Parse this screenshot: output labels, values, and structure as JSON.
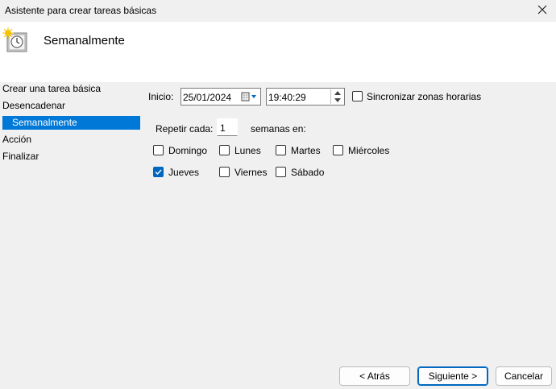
{
  "window": {
    "title": "Asistente para crear tareas básicas"
  },
  "header": {
    "title": "Semanalmente",
    "icon": "task-scheduler-icon"
  },
  "sidebar": {
    "items": [
      {
        "label": "Crear una tarea básica"
      },
      {
        "label": "Desencadenar"
      },
      {
        "label": "Semanalmente",
        "selected": true
      },
      {
        "label": "Acción"
      },
      {
        "label": "Finalizar"
      }
    ]
  },
  "form": {
    "start_label": "Inicio:",
    "start_date": "25/01/2024",
    "start_time": "19:40:29",
    "sync_label": "Sincronizar zonas horarias",
    "sync_checked": false,
    "repeat_label": "Repetir cada:",
    "repeat_value": "1",
    "weeks_on_label": "semanas en:",
    "days": [
      {
        "label": "Domingo",
        "checked": false
      },
      {
        "label": "Lunes",
        "checked": false
      },
      {
        "label": "Martes",
        "checked": false
      },
      {
        "label": "Miércoles",
        "checked": false
      },
      {
        "label": "Jueves",
        "checked": true
      },
      {
        "label": "Viernes",
        "checked": false
      },
      {
        "label": "Sábado",
        "checked": false
      }
    ]
  },
  "buttons": {
    "back": "< Atrás",
    "next": "Siguiente >",
    "cancel": "Cancelar"
  },
  "colors": {
    "accent": "#0078d7",
    "checkbox": "#0067c0"
  }
}
